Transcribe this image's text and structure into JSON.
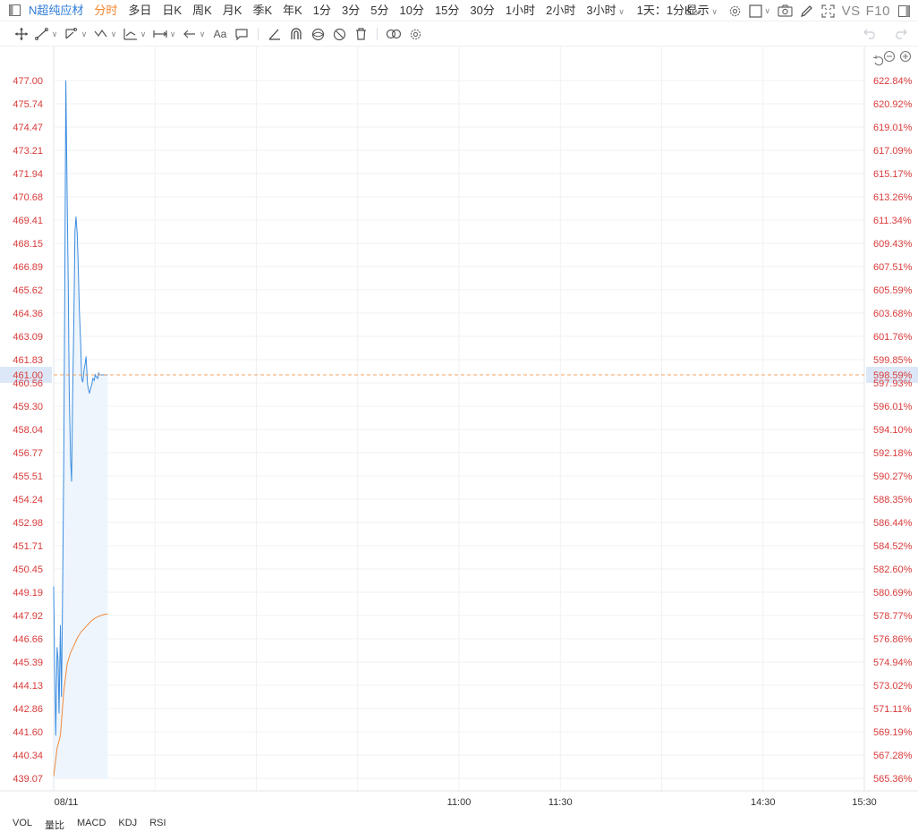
{
  "topbar": {
    "symbol": "N超纯应材",
    "periods": [
      "分时",
      "多日",
      "日K",
      "周K",
      "月K",
      "季K",
      "年K",
      "1分",
      "3分",
      "5分",
      "10分",
      "15分",
      "30分",
      "1小时",
      "2小时"
    ],
    "active_period": "分时",
    "period_more": "3小时",
    "kline_config": "1天：1分K",
    "display_label": "显示",
    "vs_label": "VS",
    "f10_label": "F10"
  },
  "toolbar": {
    "text_tool_label": "Aa"
  },
  "chart_data": {
    "type": "line",
    "left_ticks": [
      "477.00",
      "475.74",
      "474.47",
      "473.21",
      "471.94",
      "470.68",
      "469.41",
      "468.15",
      "466.89",
      "465.62",
      "464.36",
      "463.09",
      "461.83",
      "460.56",
      "459.30",
      "458.04",
      "456.77",
      "455.51",
      "454.24",
      "452.98",
      "451.71",
      "450.45",
      "449.19",
      "447.92",
      "446.66",
      "445.39",
      "444.13",
      "442.86",
      "441.60",
      "440.34",
      "439.07"
    ],
    "right_ticks": [
      "622.84%",
      "620.92%",
      "619.01%",
      "617.09%",
      "615.17%",
      "613.26%",
      "611.34%",
      "609.43%",
      "607.51%",
      "605.59%",
      "603.68%",
      "601.76%",
      "599.85%",
      "597.93%",
      "596.01%",
      "594.10%",
      "592.18%",
      "590.27%",
      "588.35%",
      "586.44%",
      "584.52%",
      "582.60%",
      "580.69%",
      "578.77%",
      "576.86%",
      "574.94%",
      "573.02%",
      "571.11%",
      "569.19%",
      "567.28%",
      "565.36%"
    ],
    "x_labels": [
      "08/11",
      "11:00",
      "11:30",
      "14:30",
      "15:30"
    ],
    "ylim": [
      439.07,
      477.0
    ],
    "current_price": "461.00",
    "current_pct": "598.59%",
    "price_series": {
      "name": "",
      "minutes": [
        0,
        0.3,
        0.6,
        1,
        1.3,
        1.6,
        2,
        2.3,
        2.6,
        3,
        3.3,
        3.6,
        4,
        4.3,
        4.6,
        5,
        5.3,
        5.6,
        6,
        6.3,
        6.6,
        7,
        7.3,
        7.6,
        8,
        8.3,
        8.6,
        9,
        9.3,
        9.6,
        10,
        10.3,
        10.6,
        11,
        11.3,
        11.6,
        12,
        12.3,
        12.6,
        13,
        13.3,
        13.6,
        14,
        14.3,
        14.6,
        15,
        15.5,
        16
      ],
      "values": [
        449.5,
        445.0,
        441.4,
        446.2,
        445.5,
        442.6,
        447.4,
        443.5,
        448.3,
        456.5,
        466.6,
        477.0,
        470.5,
        466.2,
        460.0,
        456.4,
        455.2,
        459.6,
        464.5,
        468.8,
        469.6,
        468.6,
        466.6,
        464.5,
        462.7,
        460.8,
        460.6,
        461.3,
        461.6,
        462.0,
        460.5,
        460.2,
        460.0,
        460.3,
        460.5,
        460.8,
        460.7,
        461.0,
        460.9,
        460.8,
        461.1,
        461.0,
        461.0,
        461.0,
        461.0,
        461.0,
        461.0,
        461.0
      ]
    },
    "avg_series": {
      "name": "",
      "minutes": [
        0,
        1,
        2,
        3,
        4,
        5,
        6,
        7,
        8,
        9,
        10,
        11,
        12,
        13,
        14,
        15,
        16
      ],
      "values": [
        439.2,
        440.7,
        441.4,
        443.8,
        445.3,
        445.9,
        446.3,
        446.7,
        447.0,
        447.2,
        447.4,
        447.6,
        447.75,
        447.85,
        447.92,
        447.98,
        448.0
      ]
    }
  },
  "indicator_tabs": [
    "VOL",
    "量比",
    "MACD",
    "KDJ",
    "RSI"
  ],
  "colors": {
    "accent": "#f5852c",
    "link": "#2f7cd8",
    "price_line": "#3b8de0",
    "avg_line": "#f08a3a",
    "axis_text": "#d93a3a",
    "grid": "#f0f1f3",
    "current_tag_bg": "#dce8f7"
  }
}
